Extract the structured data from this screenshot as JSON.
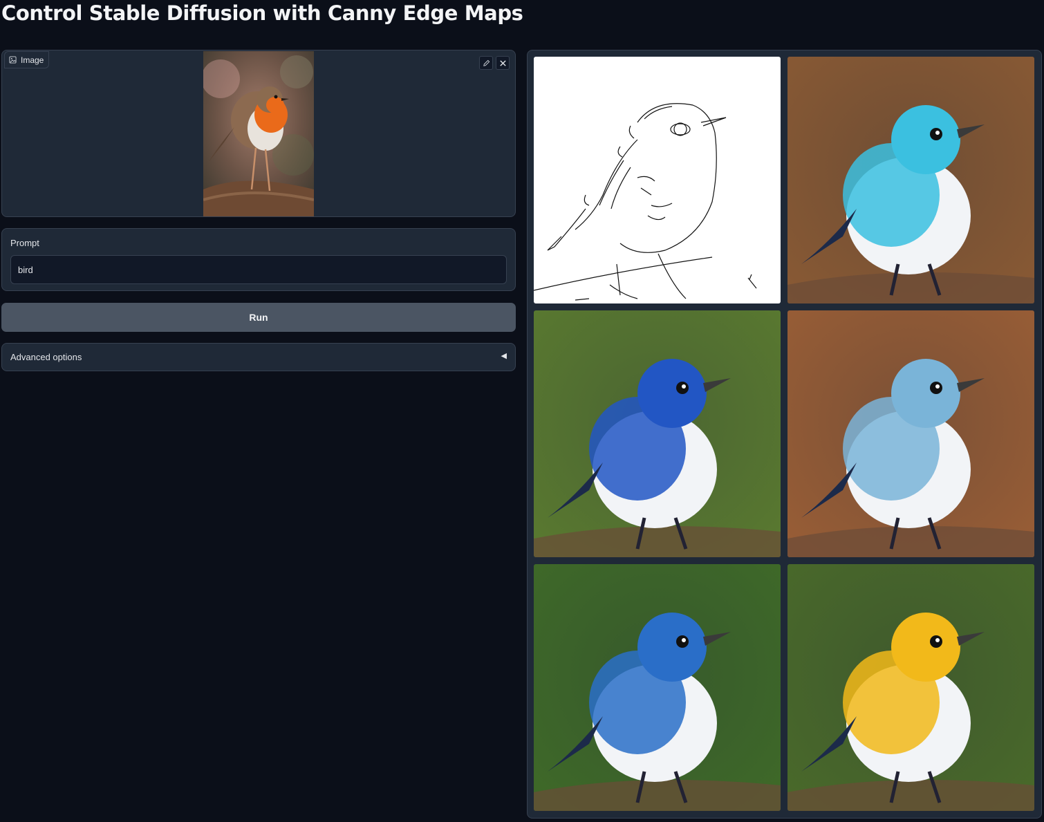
{
  "page": {
    "title": "Control Stable Diffusion with Canny Edge Maps"
  },
  "image_input": {
    "label": "Image",
    "label_icon": "image-icon",
    "edit_icon": "pencil-icon",
    "clear_icon": "close-icon"
  },
  "prompt": {
    "label": "Prompt",
    "value": "bird"
  },
  "run_button": {
    "label": "Run"
  },
  "advanced": {
    "label": "Advanced options",
    "arrow": "◀"
  },
  "gallery": {
    "items": [
      {
        "kind": "canny-edge-map"
      },
      {
        "kind": "generated-bird",
        "colors": [
          "#3bc0e0",
          "#8a5a34"
        ]
      },
      {
        "kind": "generated-bird",
        "colors": [
          "#2256c4",
          "#5a7a30"
        ]
      },
      {
        "kind": "generated-bird",
        "colors": [
          "#7ab4d8",
          "#9a5e36"
        ]
      },
      {
        "kind": "generated-bird",
        "colors": [
          "#2a6ec8",
          "#3f6a28"
        ]
      },
      {
        "kind": "generated-bird",
        "colors": [
          "#f2b91a",
          "#4a6a2a"
        ]
      }
    ]
  }
}
